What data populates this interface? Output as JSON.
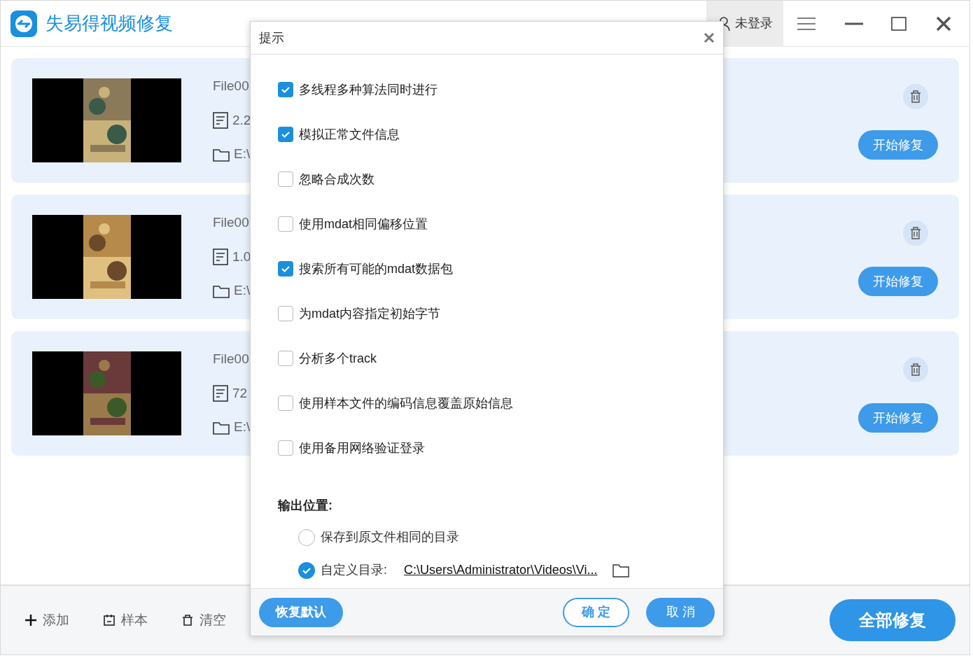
{
  "app": {
    "title": "失易得视频修复",
    "user": "未登录"
  },
  "files": [
    {
      "name": "File00",
      "size": "2.2",
      "path": "E:\\",
      "action": "开始修复"
    },
    {
      "name": "File00",
      "size": "1.0",
      "path": "E:\\",
      "action": "开始修复"
    },
    {
      "name": "File00",
      "size": "72",
      "path": "E:\\",
      "action": "开始修复"
    }
  ],
  "toolbar": {
    "items": [
      {
        "kind": "add",
        "label": "添加"
      },
      {
        "kind": "sample",
        "label": "样本"
      },
      {
        "kind": "clear",
        "label": "清空"
      }
    ],
    "primary": "全部修复"
  },
  "dialog": {
    "title": "提示",
    "options": [
      {
        "label": "多线程多种算法同时进行",
        "checked": true
      },
      {
        "label": "模拟正常文件信息",
        "checked": true
      },
      {
        "label": "忽略合成次数",
        "checked": false
      },
      {
        "label": "使用mdat相同偏移位置",
        "checked": false
      },
      {
        "label": "搜索所有可能的mdat数据包",
        "checked": true
      },
      {
        "label": "为mdat内容指定初始字节",
        "checked": false
      },
      {
        "label": "分析多个track",
        "checked": false
      },
      {
        "label": "使用样本文件的编码信息覆盖原始信息",
        "checked": false
      },
      {
        "label": "使用备用网络验证登录",
        "checked": false
      }
    ],
    "output_heading": "输出位置:",
    "output_choices": [
      {
        "label": "保存到原文件相同的目录",
        "selected": false
      },
      {
        "label": "自定义目录:",
        "selected": true,
        "path": "C:\\Users\\Administrator\\Videos\\Vi..."
      }
    ],
    "buttons": [
      {
        "kind": "reset",
        "label": "恢复默认"
      },
      {
        "kind": "ok",
        "label": "确 定"
      },
      {
        "kind": "cancel",
        "label": "取 消"
      }
    ]
  }
}
